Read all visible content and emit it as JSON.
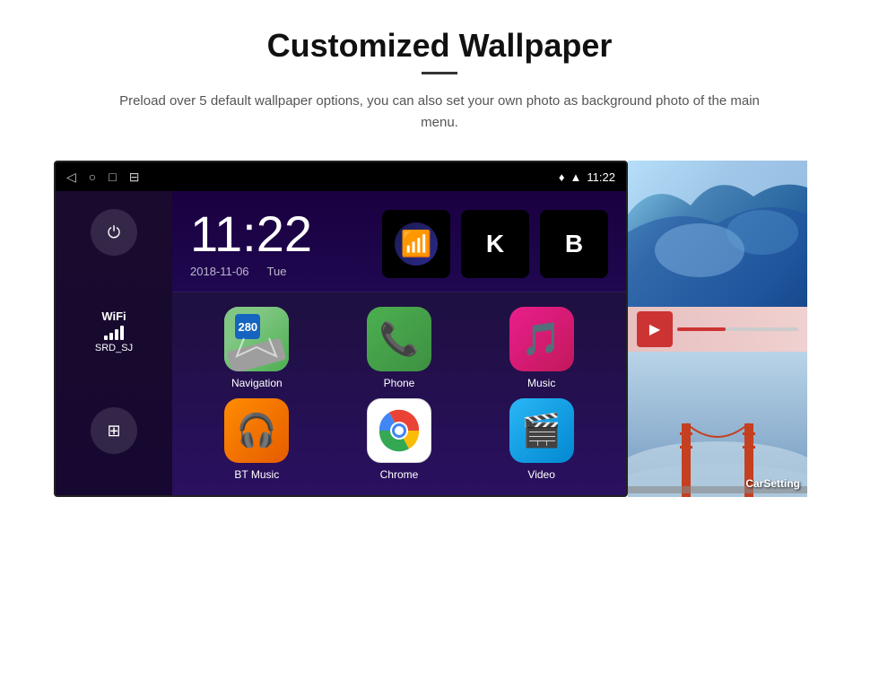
{
  "header": {
    "title": "Customized Wallpaper",
    "description": "Preload over 5 default wallpaper options, you can also set your own photo as background photo of the main menu."
  },
  "status_bar": {
    "time": "11:22",
    "icons": [
      "back-nav",
      "home-nav",
      "recent-nav",
      "gallery-nav"
    ]
  },
  "clock": {
    "time": "11:22",
    "date": "2018-11-06",
    "day": "Tue"
  },
  "wifi": {
    "label": "WiFi",
    "network": "SRD_SJ"
  },
  "apps": [
    {
      "id": "navigation",
      "label": "Navigation",
      "type": "nav"
    },
    {
      "id": "phone",
      "label": "Phone",
      "type": "phone"
    },
    {
      "id": "music",
      "label": "Music",
      "type": "music"
    },
    {
      "id": "bt-music",
      "label": "BT Music",
      "type": "bt"
    },
    {
      "id": "chrome",
      "label": "Chrome",
      "type": "chrome"
    },
    {
      "id": "video",
      "label": "Video",
      "type": "video"
    }
  ],
  "wallpapers": [
    {
      "id": "ice",
      "label": ""
    },
    {
      "id": "bridge",
      "label": "CarSetting"
    }
  ],
  "widgets": [
    {
      "id": "signal",
      "type": "wifi-signal"
    },
    {
      "id": "k",
      "label": "K"
    },
    {
      "id": "b",
      "label": "B"
    }
  ]
}
